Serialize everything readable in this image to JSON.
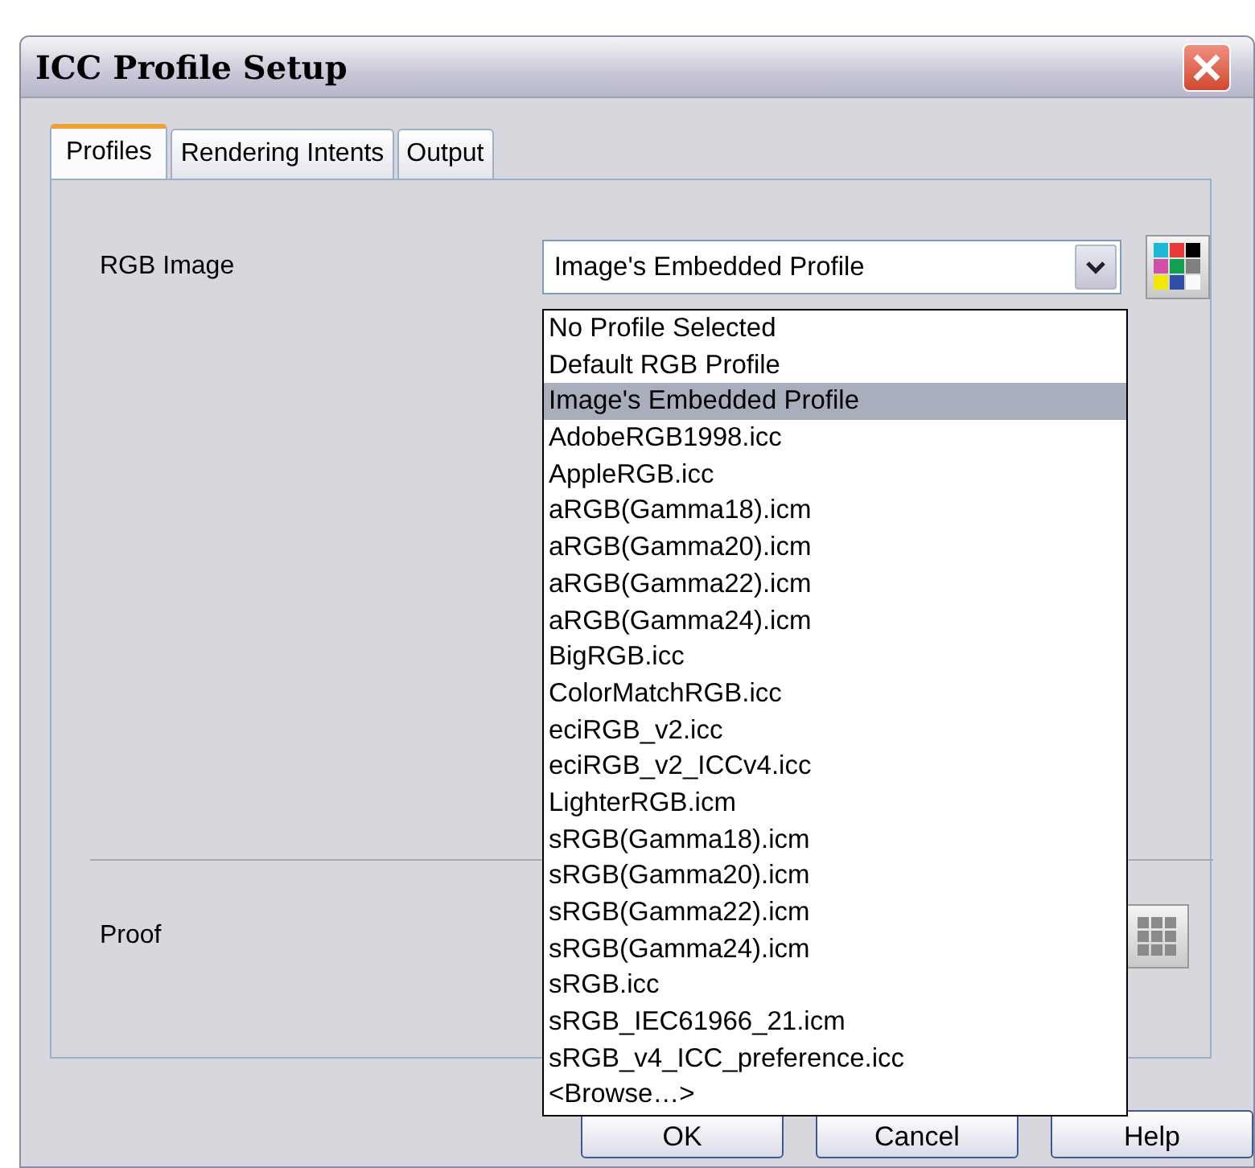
{
  "window": {
    "title": "ICC Profile Setup"
  },
  "tabs": [
    {
      "label": "Profiles",
      "selected": true
    },
    {
      "label": "Rendering Intents",
      "selected": false
    },
    {
      "label": "Output",
      "selected": false
    }
  ],
  "rgb_image": {
    "label": "RGB Image",
    "value": "Image's Embedded Profile",
    "expanded": true,
    "options": [
      {
        "label": "No Profile Selected",
        "selected": false
      },
      {
        "label": "Default RGB Profile",
        "selected": false
      },
      {
        "label": "Image's Embedded Profile",
        "selected": true
      },
      {
        "label": "AdobeRGB1998.icc",
        "selected": false
      },
      {
        "label": "AppleRGB.icc",
        "selected": false
      },
      {
        "label": "aRGB(Gamma18).icm",
        "selected": false
      },
      {
        "label": "aRGB(Gamma20).icm",
        "selected": false
      },
      {
        "label": "aRGB(Gamma22).icm",
        "selected": false
      },
      {
        "label": "aRGB(Gamma24).icm",
        "selected": false
      },
      {
        "label": "BigRGB.icc",
        "selected": false
      },
      {
        "label": "ColorMatchRGB.icc",
        "selected": false
      },
      {
        "label": "eciRGB_v2.icc",
        "selected": false
      },
      {
        "label": "eciRGB_v2_ICCv4.icc",
        "selected": false
      },
      {
        "label": "LighterRGB.icm",
        "selected": false
      },
      {
        "label": "sRGB(Gamma18).icm",
        "selected": false
      },
      {
        "label": "sRGB(Gamma20).icm",
        "selected": false
      },
      {
        "label": "sRGB(Gamma22).icm",
        "selected": false
      },
      {
        "label": "sRGB(Gamma24).icm",
        "selected": false
      },
      {
        "label": "sRGB.icc",
        "selected": false
      },
      {
        "label": "sRGB_IEC61966_21.icm",
        "selected": false
      },
      {
        "label": "sRGB_v4_ICC_preference.icc",
        "selected": false
      },
      {
        "label": "<Browse…>",
        "selected": false
      }
    ]
  },
  "proof": {
    "label": "Proof"
  },
  "buttons": [
    "OK",
    "Cancel",
    "Help"
  ]
}
